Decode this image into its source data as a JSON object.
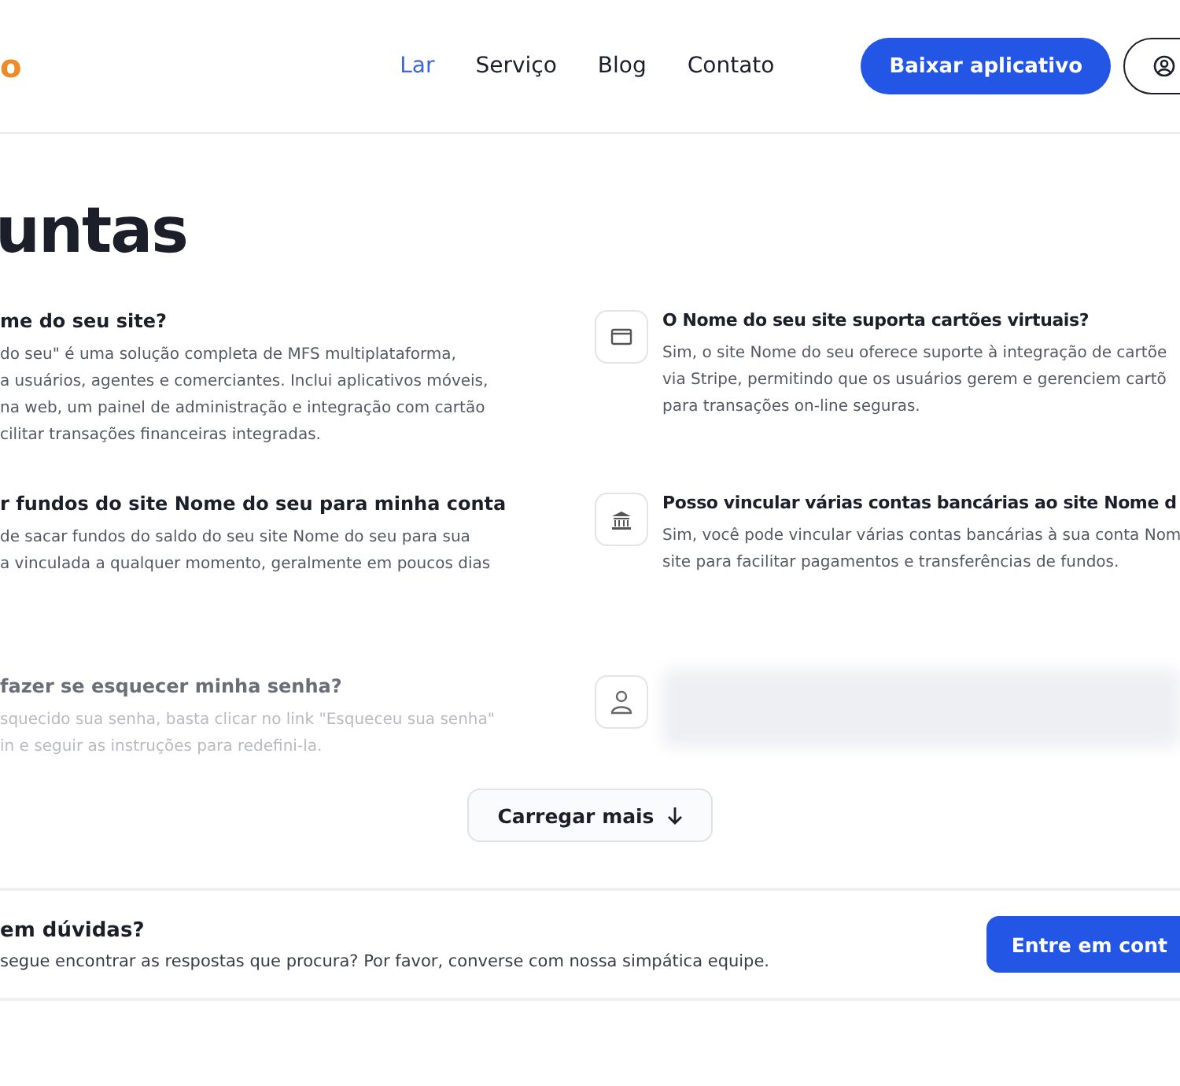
{
  "header": {
    "logo": "o",
    "nav": [
      {
        "label": "Lar",
        "selected": true
      },
      {
        "label": "Serviço",
        "selected": false
      },
      {
        "label": "Blog",
        "selected": false
      },
      {
        "label": "Contato",
        "selected": false
      }
    ],
    "download_button": "Baixar aplicativo"
  },
  "title": "untas",
  "faqs_left": [
    {
      "question": "me do seu site?",
      "answer": "do seu\" é uma solução completa de MFS multiplataforma,\na usuários, agentes e comerciantes. Inclui aplicativos móveis,\nna web, um painel de administração e integração com cartão\ncilitar transações financeiras integradas.",
      "faded": false
    },
    {
      "question": "r fundos do site Nome do seu para minha conta",
      "answer": "de sacar fundos do saldo do seu site Nome do seu para sua\na vinculada a qualquer momento, geralmente em poucos dias",
      "faded": false
    },
    {
      "question": "fazer se esquecer minha senha?",
      "answer": "squecido sua senha, basta clicar no link \"Esqueceu sua senha\"\nin e seguir as instruções para redefini-la.",
      "faded": true
    }
  ],
  "faqs_right": [
    {
      "kind": "card",
      "question": "O Nome do seu site suporta cartões virtuais?",
      "answer": "Sim, o site Nome do seu oferece suporte à integração de cartõe\nvia Stripe, permitindo que os usuários gerem e gerenciem cartõ\npara transações on-line seguras."
    },
    {
      "kind": "bank",
      "question": "Posso vincular várias contas bancárias ao site Nome d",
      "answer": "Sim, você pode vincular várias contas bancárias à sua conta Nom\nsite para facilitar pagamentos e transferências de fundos."
    },
    {
      "kind": "user",
      "blurred": true
    }
  ],
  "load_more": "Carregar mais",
  "contact": {
    "title": "em dúvidas?",
    "text": "segue encontrar as respostas que procura? Por favor, converse com nossa simpática equipe.",
    "button": "Entre em cont"
  }
}
